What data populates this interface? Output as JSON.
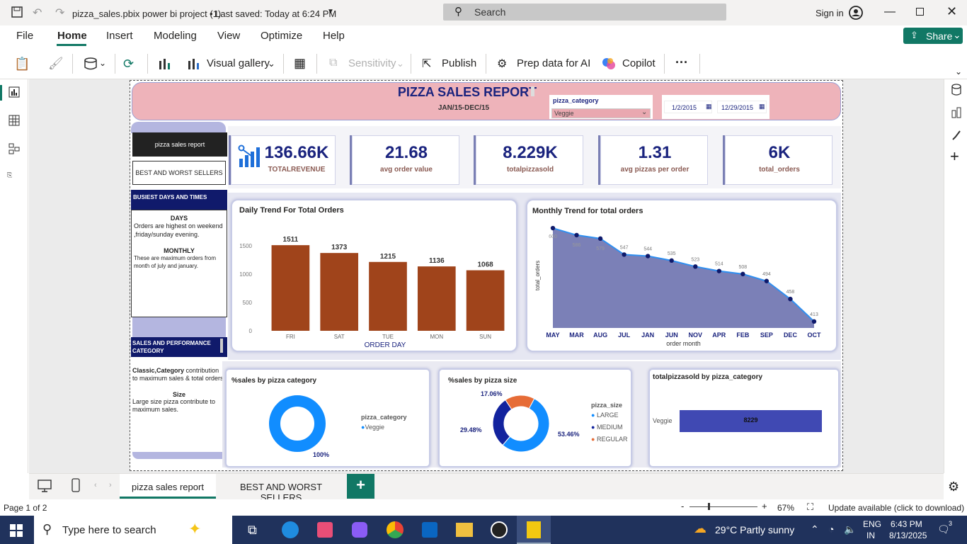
{
  "window": {
    "file_title": "pizza_sales.pbix power bi project (1)",
    "saved": "• Last saved: Today at 6:24 PM",
    "search_placeholder": "Search",
    "signin": "Sign in"
  },
  "menu": [
    "File",
    "Home",
    "Insert",
    "Modeling",
    "View",
    "Optimize",
    "Help"
  ],
  "share_label": "Share",
  "ribbon": {
    "visual_gallery": "Visual gallery",
    "sensitivity": "Sensitivity",
    "publish": "Publish",
    "prep_data": "Prep data for AI",
    "copilot": "Copilot",
    "more": "···"
  },
  "report": {
    "title": "PIZZA SALES REPORT",
    "subtitle": "JAN/15-DEC/15",
    "slicer_label": "pizza_category",
    "slicer_value": "Veggie",
    "date_from": "1/2/2015",
    "date_to": "12/29/2015"
  },
  "side": {
    "nav_active": "pizza sales report",
    "nav_other": "BEST AND WORST SELLERS",
    "busiest_header": "BUSIEST DAYS AND TIMES",
    "days_title": "DAYS",
    "days_text": "Orders are highest on weekend ,friday/sunday evening.",
    "monthly_title": "MONTHLY",
    "monthly_text": "These are maximum orders from month of july and january.",
    "sales_header": "SALES AND PERFORMANCE CATEGORY",
    "classic_bold": "Classic,Category",
    "classic_text": " contribution to maximum sales & total orders.",
    "size_title": "Size",
    "size_text": "Large size pizza contribute to maximum sales."
  },
  "kpis": [
    {
      "value": "136.66K",
      "label": "TOTALREVENUE"
    },
    {
      "value": "21.68",
      "label": "avg order value"
    },
    {
      "value": "8.229K",
      "label": "totalpizzasold"
    },
    {
      "value": "1.31",
      "label": "avg pizzas per order"
    },
    {
      "value": "6K",
      "label": "total_orders"
    }
  ],
  "colors": {
    "bar": "#a0441b",
    "area": "#7b80b7",
    "line": "#2f8ff0",
    "navy": "#101a6b",
    "donut_blue": "#118dff",
    "donut_navy": "#12239e",
    "donut_orange": "#e66c37"
  },
  "chart_data": [
    {
      "type": "bar",
      "title": "Daily Trend For Total Orders",
      "xlabel": "ORDER DAY",
      "ylabel": "",
      "categories": [
        "FRI",
        "SAT",
        "TUE",
        "MON",
        "SUN"
      ],
      "values": [
        1511,
        1373,
        1215,
        1136,
        1068
      ],
      "yticks": [
        0,
        500,
        1000,
        1500
      ],
      "ylim": [
        0,
        1600
      ]
    },
    {
      "type": "area",
      "title": "Monthly Trend for total orders",
      "xlabel": "order month",
      "ylabel": "total_orders",
      "categories": [
        "MAY",
        "MAR",
        "AUG",
        "JUL",
        "JAN",
        "JUN",
        "NOV",
        "APR",
        "FEB",
        "SEP",
        "DEC",
        "OCT"
      ],
      "values": [
        600,
        586,
        579,
        547,
        544,
        535,
        523,
        514,
        508,
        494,
        458,
        413
      ],
      "ylim": [
        400,
        610
      ]
    },
    {
      "type": "pie",
      "title": "%sales by pizza category",
      "legend_title": "pizza_category",
      "labels": [
        "Veggie"
      ],
      "values": [
        100
      ],
      "value_labels": [
        "100%"
      ]
    },
    {
      "type": "pie",
      "title": "%sales by pizza size",
      "legend_title": "pizza_size",
      "labels": [
        "LARGE",
        "MEDIUM",
        "REGULAR"
      ],
      "values": [
        53.46,
        29.48,
        17.06
      ],
      "value_labels": [
        "53.46%",
        "29.48%",
        "17.06%"
      ]
    },
    {
      "type": "bar",
      "title": "totalpizzasold by pizza_category",
      "categories": [
        "Veggie"
      ],
      "values": [
        8229
      ],
      "value_labels": [
        "8229"
      ]
    }
  ],
  "tabs": [
    "pizza sales report",
    "BEST AND WORST SELLERS"
  ],
  "status": {
    "page": "Page 1 of 2",
    "zoom": "67%",
    "update": "Update available (click to download)"
  },
  "taskbar": {
    "search": "Type here to search",
    "weather": "29°C  Partly sunny",
    "lang1": "ENG",
    "lang2": "IN",
    "time": "6:43 PM",
    "date": "8/13/2025",
    "notif": "3"
  }
}
